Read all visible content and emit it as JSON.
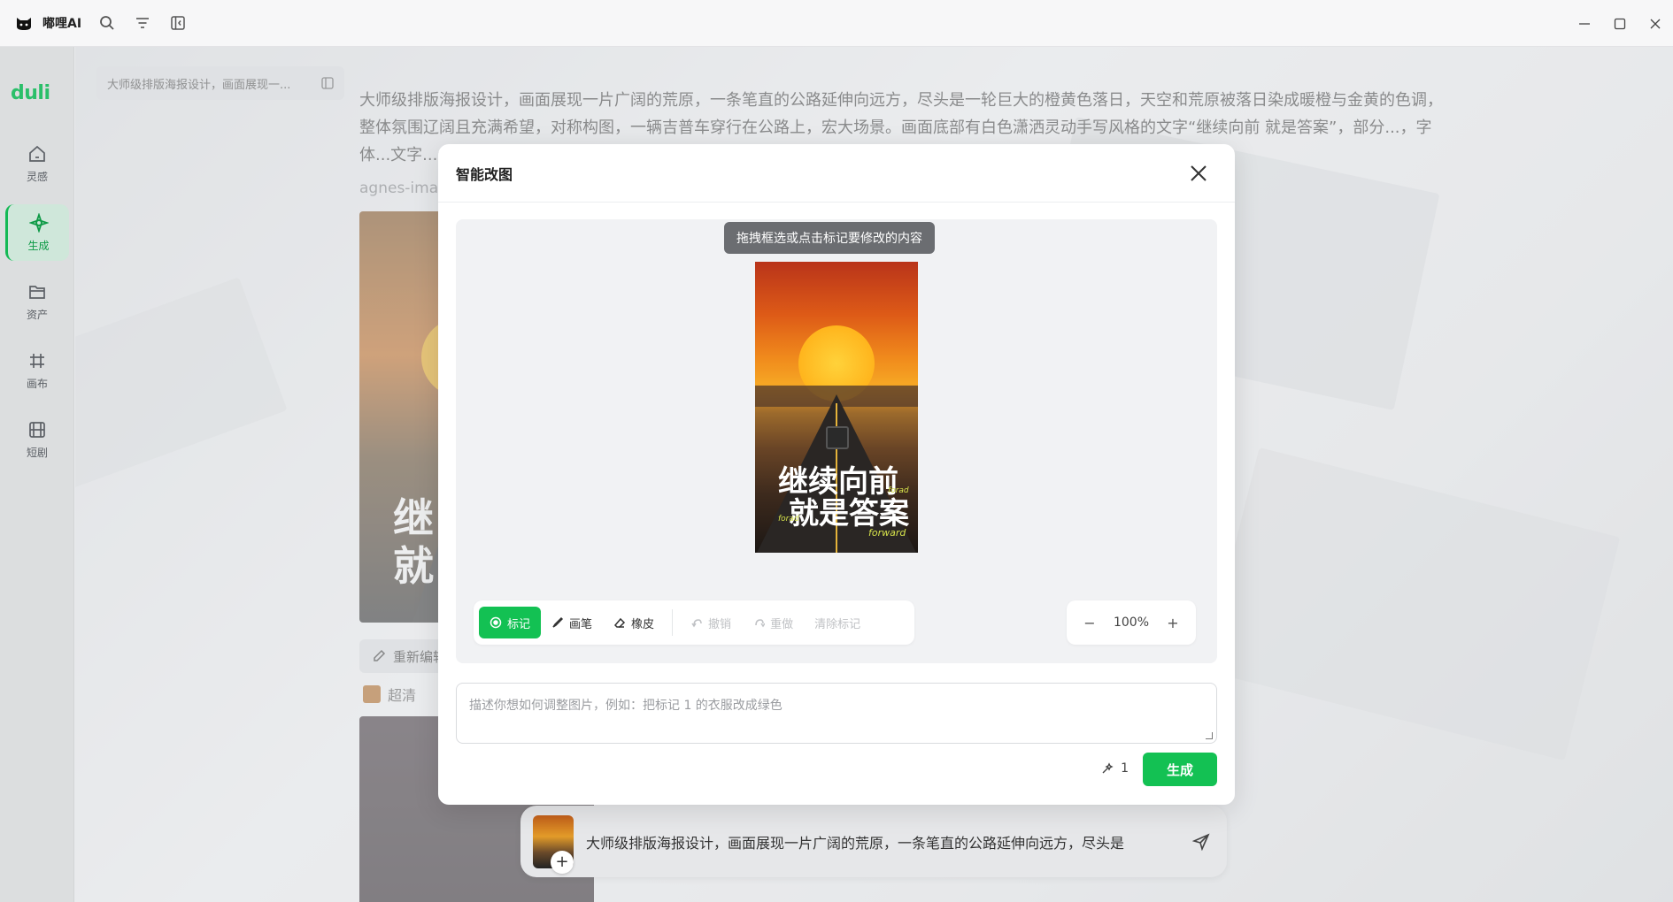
{
  "app": {
    "title": "嘟哩AI",
    "brand": "duli"
  },
  "colors": {
    "accent": "#13c153",
    "brand": "#2bbf6a"
  },
  "sidebar": {
    "items": [
      {
        "label": "灵感",
        "icon": "home-icon"
      },
      {
        "label": "生成",
        "icon": "sparkle-icon",
        "active": true
      },
      {
        "label": "资产",
        "icon": "folder-icon"
      },
      {
        "label": "画布",
        "icon": "grid-icon"
      },
      {
        "label": "短剧",
        "icon": "film-icon"
      }
    ]
  },
  "background": {
    "history_title": "大师级排版海报设计，画面展现一...",
    "prompt": "大师级排版海报设计，画面展现一片广阔的荒原，一条笔直的公路延伸向远方，尽头是一轮巨大的橙黄色落日，天空和荒原被落日染成暖橙与金黄的色调，整体氛围辽阔且充满希望，对称构图，一辆吉普车穿行在公路上，宏大场景。画面底部有白色潇洒灵动手写风格的文字“继续向前 就是答案”，部分...，字体...文字...合...，画面中也有黄色小字英文装饰“forward”。",
    "meta": "agnes-ima...",
    "poster_text_1": "继",
    "poster_text_2": "就",
    "action_label": "重新编辑",
    "tag_label": "超清"
  },
  "input_bar": {
    "text": "大师级排版海报设计，画面展现一片广阔的荒原，一条笔直的公路延伸向远方，尽头是"
  },
  "modal": {
    "title": "智能改图",
    "hint": "拖拽框选或点击标记要修改的内容",
    "poster": {
      "line1": "继续向前",
      "line2": "就是答案",
      "en1": "forad",
      "en2": "forad",
      "en3": "forward"
    },
    "tools": {
      "mark": "标记",
      "brush": "画笔",
      "eraser": "橡皮",
      "undo": "撤销",
      "redo": "重做",
      "clear": "清除标记"
    },
    "zoom": {
      "minus": "−",
      "value": "100%",
      "plus": "+"
    },
    "description_placeholder": "描述你想如何调整图片，例如：把标记 1 的衣服改成绿色",
    "credits": "1",
    "generate_label": "生成"
  }
}
